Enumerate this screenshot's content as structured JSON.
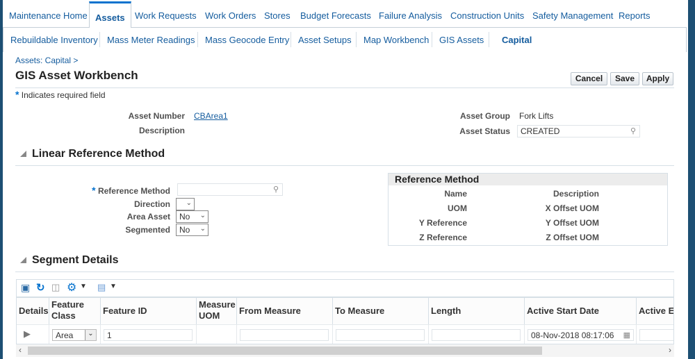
{
  "top_tabs": [
    "Maintenance Home",
    "Assets",
    "Work Requests",
    "Work Orders",
    "Stores",
    "Budget Forecasts",
    "Failure Analysis",
    "Construction Units",
    "Safety Management",
    "Reports"
  ],
  "active_tab": "Assets",
  "sub_tabs": [
    "Rebuildable Inventory",
    "Mass Meter Readings",
    "Mass Geocode Entry",
    "Asset Setups",
    "Map Workbench",
    "GIS Assets",
    "Capital"
  ],
  "active_sub_tab": "Capital",
  "breadcrumb": "Assets: Capital  >",
  "page_title": "GIS Asset Workbench",
  "buttons": {
    "cancel": "Cancel",
    "save": "Save",
    "apply": "Apply"
  },
  "required_note": "Indicates required field",
  "header": {
    "asset_number_label": "Asset Number",
    "asset_number": "CBArea1",
    "description_label": "Description",
    "asset_group_label": "Asset Group",
    "asset_group": "Fork Lifts",
    "asset_status_label": "Asset Status",
    "asset_status": "CREATED"
  },
  "lrm": {
    "title": "Linear Reference Method",
    "reference_method_label": "Reference Method",
    "reference_method": "",
    "direction_label": "Direction",
    "direction": "",
    "area_asset_label": "Area Asset",
    "area_asset": "No",
    "segmented_label": "Segmented",
    "segmented": "No"
  },
  "ref_method_box": {
    "title": "Reference Method",
    "rows": [
      [
        "Name",
        "Description"
      ],
      [
        "UOM",
        "X Offset UOM"
      ],
      [
        "Y Reference",
        "Y Offset UOM"
      ],
      [
        "Z Reference",
        "Z Offset UOM"
      ]
    ]
  },
  "segment": {
    "title": "Segment Details",
    "columns": [
      "Details",
      "Feature Class",
      "Feature ID",
      "Measure UOM",
      "From Measure",
      "To Measure",
      "Length",
      "Active Start Date",
      "Active E"
    ],
    "row": {
      "feature_class": "Area",
      "feature_id": "1",
      "active_start_date": "08-Nov-2018 08:17:06"
    }
  },
  "colors": {
    "link": "#145c9e",
    "accent": "#0572ce",
    "frame": "#1d4f73"
  }
}
